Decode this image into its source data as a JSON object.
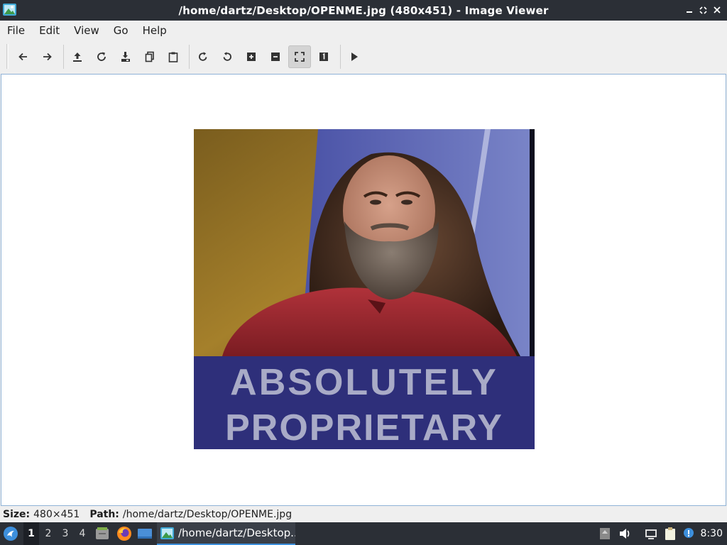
{
  "window": {
    "title": "/home/dartz/Desktop/OPENME.jpg (480x451) - Image Viewer"
  },
  "menu": [
    "File",
    "Edit",
    "View",
    "Go",
    "Help"
  ],
  "toolbar": {
    "icons": [
      "back-icon",
      "forward-icon",
      "upload-icon",
      "reload-icon",
      "save-icon",
      "copy-icon",
      "paste-icon",
      "rotate-cw-icon",
      "rotate-ccw-icon",
      "zoom-in-icon",
      "zoom-out-icon",
      "fit-window-icon",
      "original-size-icon",
      "slideshow-icon"
    ],
    "pressed": "fit-window-icon"
  },
  "image": {
    "caption_line1": "ABSOLUTELY",
    "caption_line2": "PROPRIETARY"
  },
  "status": {
    "size_label": "Size:",
    "size_value": "480×451",
    "path_label": "Path:",
    "path_value": "/home/dartz/Desktop/OPENME.jpg"
  },
  "taskbar": {
    "workspaces": [
      "1",
      "2",
      "3",
      "4"
    ],
    "active_workspace": "1",
    "task_label": "/home/dartz/Desktop...",
    "clock": "8:30"
  },
  "colors": {
    "titlebar": "#2b2f36",
    "accent": "#3d8fdc",
    "caption_band": "#2e2f7a"
  }
}
